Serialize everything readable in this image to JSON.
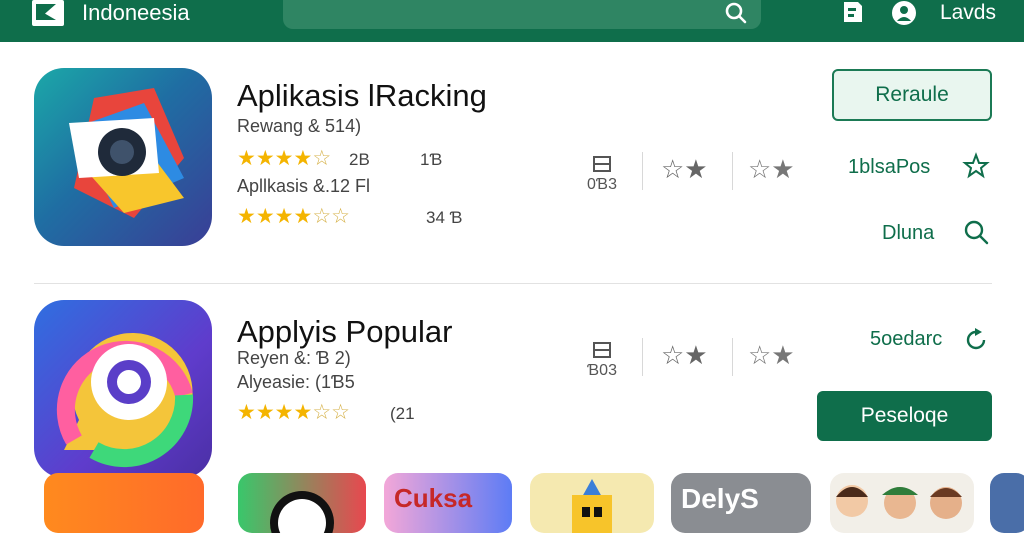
{
  "topbar": {
    "brand": "Indoneesia",
    "user_label": "Lavds",
    "search_placeholder": ""
  },
  "apps": [
    {
      "title": "Aplikasis lRacking",
      "meta1": "Rewang & 514)",
      "rating_text": "2B",
      "rating_extra": "1Ɓ",
      "meta2": "Apllkasis &.12 Fl",
      "meta2_count": "34 Ɓ",
      "stat_value": "0Ɓ3",
      "action_button": "Reraule",
      "link_top": "1blsaPos",
      "link_bottom": "Dluna"
    },
    {
      "title": "Applyis Popular",
      "meta1": "Reyen &: Ɓ 2)",
      "meta2": "Alyeasie: (1Ɓ5",
      "rating_text": "(21",
      "stat_value": "Ɓ03",
      "link_top": "5oedarc",
      "action_button": "Peseloqe"
    }
  ],
  "thumbs": {
    "t3_label": "Cuksa",
    "t5_label": "DelyS"
  },
  "colors": {
    "primary": "#0f6e4b",
    "star": "#f4b400"
  }
}
